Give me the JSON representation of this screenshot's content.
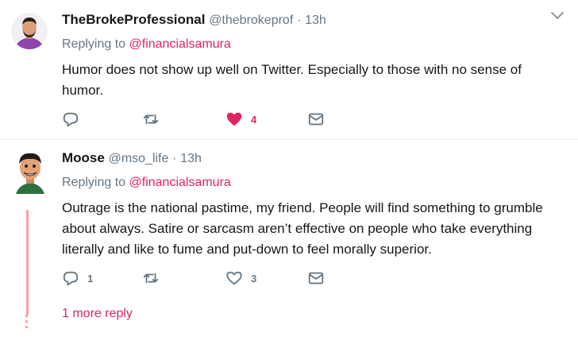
{
  "tweets": [
    {
      "name": "TheBrokeProfessional",
      "handle": "@thebrokeprof",
      "time": "13h",
      "reply_prefix": "Replying to",
      "reply_to": "@financialsamura",
      "text": "Humor does not show up well on Twitter. Especially to those with no sense of humor.",
      "replies": "",
      "retweets": "",
      "likes": "4",
      "liked": true
    },
    {
      "name": "Moose",
      "handle": "@mso_life",
      "time": "13h",
      "reply_prefix": "Replying to",
      "reply_to": "@financialsamura",
      "text": "Outrage is the national pastime, my friend. People will find something to grumble about always. Satire or sarcasm aren’t effective on people who take everything literally and like to fume and put-down to feel morally superior.",
      "replies": "1",
      "retweets": "",
      "likes": "3",
      "liked": false,
      "more_replies": "1 more reply"
    }
  ],
  "separator": "·",
  "colors": {
    "accent": "#e0245e",
    "muted": "#657786",
    "thread": "#ff9ea0"
  },
  "icons": [
    "reply-icon",
    "retweet-icon",
    "like-icon",
    "message-icon",
    "chevron-down-icon"
  ]
}
